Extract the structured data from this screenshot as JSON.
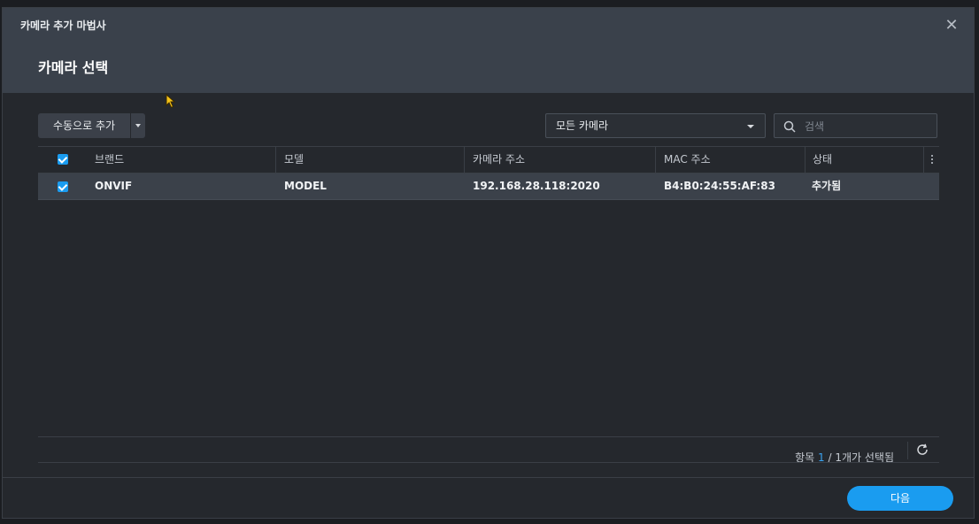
{
  "wizard": {
    "title": "카메라 추가 마법사",
    "step_title": "카메라 선택"
  },
  "toolbar": {
    "add_manual_label": "수동으로 추가",
    "filter_selected": "모든 카메라",
    "search_placeholder": "검색"
  },
  "table": {
    "columns": [
      "브랜드",
      "모델",
      "카메라 주소",
      "MAC 주소",
      "상태"
    ],
    "rows": [
      {
        "brand": "ONVIF",
        "model": "MODEL",
        "address": "192.168.28.118:2020",
        "mac": "B4:B0:24:55:AF:83",
        "status": "추가됨",
        "checked": true
      }
    ]
  },
  "pager": {
    "items_label": "항목",
    "count": "1",
    "separator": "/",
    "selected_label": "1개가 선택됨"
  },
  "footer": {
    "next_label": "다음"
  },
  "colors": {
    "accent": "#1a9cf0",
    "header_bg": "#3a414b",
    "body_bg": "#25282d"
  },
  "icons": {
    "close": "close-icon",
    "search": "search-icon",
    "refresh": "refresh-icon",
    "more": "more-vertical-icon"
  }
}
